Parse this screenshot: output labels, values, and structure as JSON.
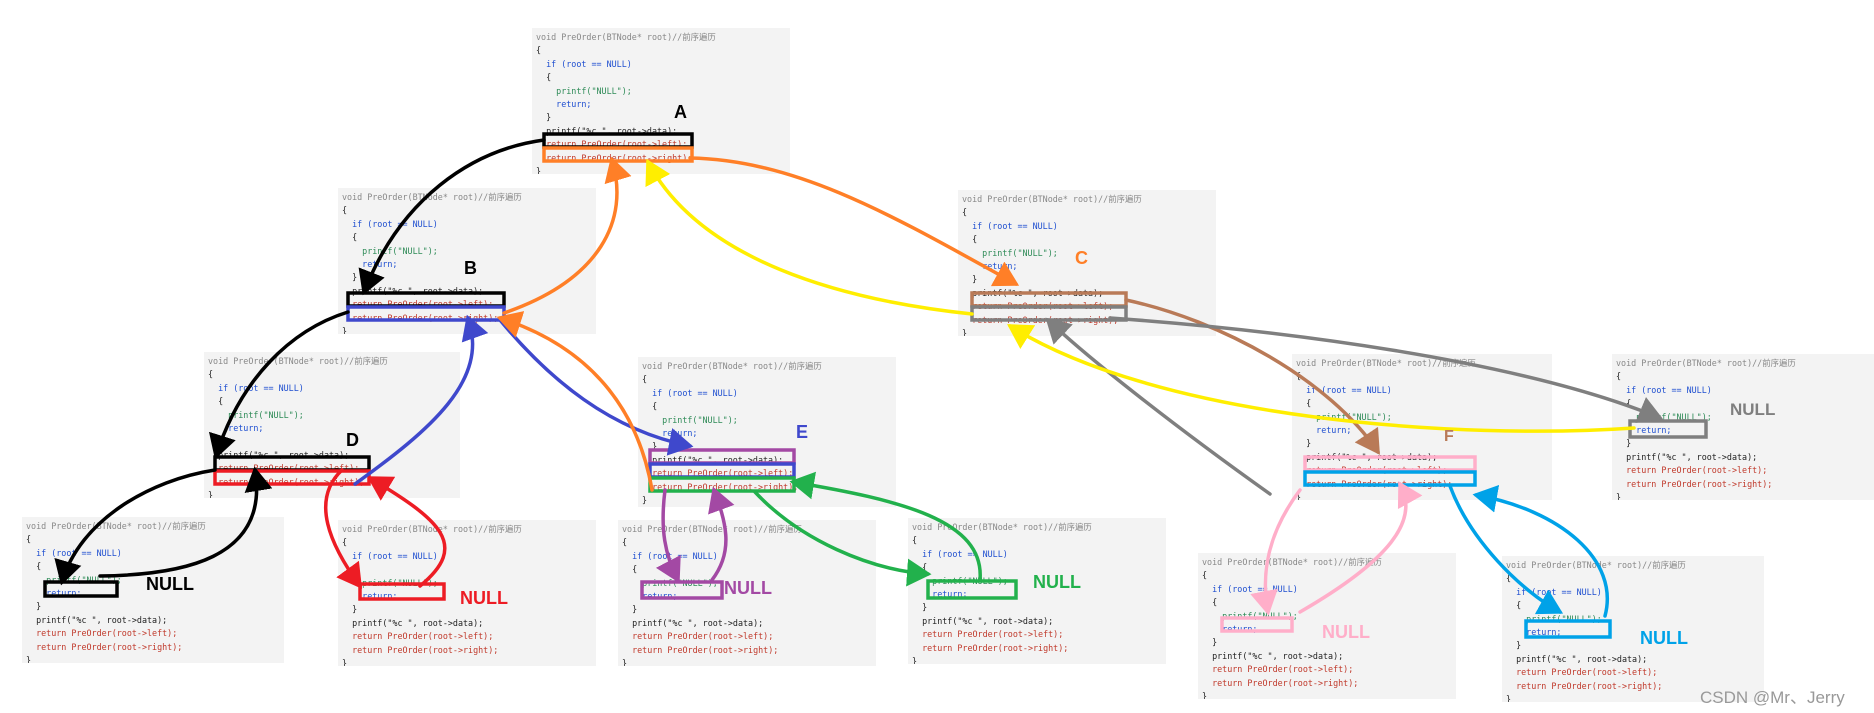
{
  "code": {
    "l1": "void PreOrder(BTNode* root)//前序遍历",
    "l2": "{",
    "l3": "  if (root == NULL)",
    "l4": "  {",
    "l5": "    printf(\"NULL\");",
    "l6": "    return;",
    "l7": "  }",
    "l8": "  printf(\"%c \", root->data);",
    "l9": "  return PreOrder(root->left);",
    "l10": "  return PreOrder(root->right);",
    "l11": "}"
  },
  "labels": {
    "A": "A",
    "B": "B",
    "C": "C",
    "D": "D",
    "E": "E",
    "F": "F",
    "null": "NULL"
  },
  "colors": {
    "black": "#000000",
    "orange": "#ff7f27",
    "yellow": "#ffee00",
    "blue": "#3f48cc",
    "red": "#ed1c24",
    "purple": "#a349a4",
    "green": "#22b14c",
    "brown": "#b97a57",
    "gray": "#7f7f7f",
    "pink": "#ffaec9",
    "cyan": "#00a2e8"
  },
  "watermark": "CSDN @Mr、Jerry"
}
